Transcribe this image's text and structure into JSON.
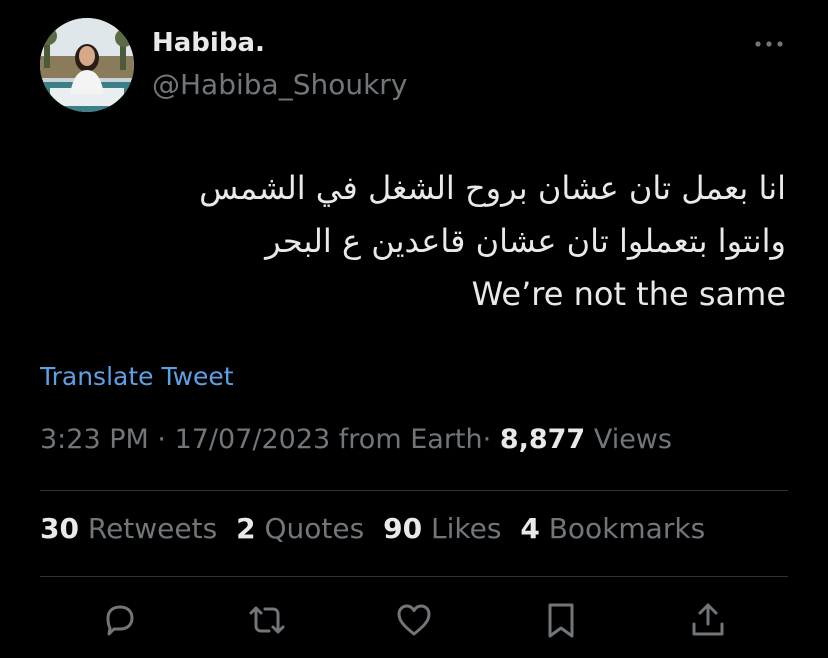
{
  "author": {
    "display_name": "Habiba.",
    "handle": "@Habiba_Shoukry"
  },
  "tweet": {
    "lines": [
      "انا بعمل تان عشان بروح الشغل في الشمس",
      "وانتوا بتعملوا تان عشان قاعدين ع البحر",
      "We’re not the same"
    ]
  },
  "translate_label": "Translate Tweet",
  "meta": {
    "time": "3:23 PM",
    "separator": "·",
    "date": "17/07/2023",
    "source": "from Earth",
    "views_count": "8,877",
    "views_label": "Views"
  },
  "stats": {
    "retweets_count": "30",
    "retweets_label": "Retweets",
    "quotes_count": "2",
    "quotes_label": "Quotes",
    "likes_count": "90",
    "likes_label": "Likes",
    "bookmarks_count": "4",
    "bookmarks_label": "Bookmarks"
  },
  "icons": {
    "more": "more-dots-icon",
    "reply": "reply-icon",
    "retweet": "retweet-icon",
    "like": "heart-icon",
    "bookmark": "bookmark-icon",
    "share": "share-icon"
  },
  "colors": {
    "background": "#000000",
    "text": "#e7e9ea",
    "secondary": "#71767b",
    "link": "#5fa0e4",
    "divider": "#2f3336"
  }
}
